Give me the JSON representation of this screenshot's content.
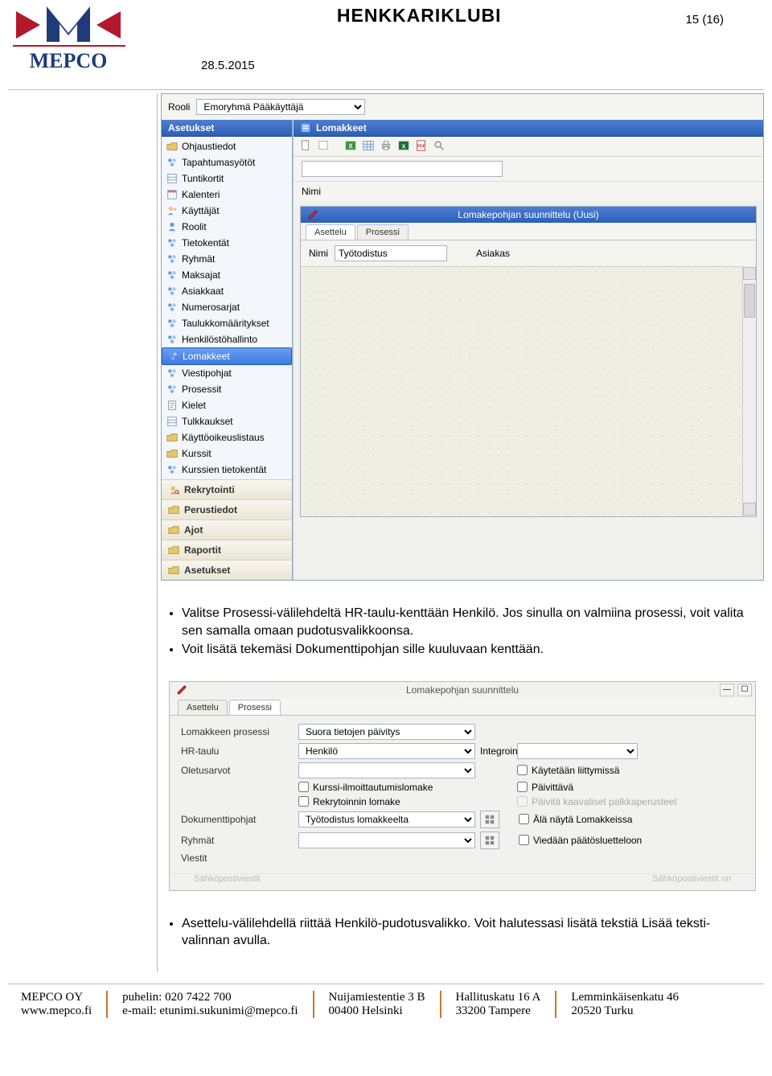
{
  "doc": {
    "title": "HENKKARIKLUBI",
    "page_label": "15 (16)",
    "date": "28.5.2015"
  },
  "app1": {
    "rooli_label": "Rooli",
    "rooli_value": "Emoryhmä Pääkäyttäjä",
    "sidebar_title": "Asetukset",
    "content_title": "Lomakkeet",
    "nav": [
      "Ohjaustiedot",
      "Tapahtumasyötöt",
      "Tuntikortit",
      "Kalenteri",
      "Käyttäjät",
      "Roolit",
      "Tietokentät",
      "Ryhmät",
      "Maksajat",
      "Asiakkaat",
      "Numerosarjat",
      "Taulukkomääritykset",
      "Henkilöstöhallinto",
      "Lomakkeet",
      "Viestipohjat",
      "Prosessit",
      "Kielet",
      "Tulkkaukset",
      "Käyttöoikeuslistaus",
      "Kurssit",
      "Kurssien tietokentät"
    ],
    "nav_selected_index": 13,
    "side_buttons": [
      "Rekrytointi",
      "Perustiedot",
      "Ajot",
      "Raportit",
      "Asetukset"
    ],
    "search_label": "Nimi",
    "subwin_title_text": "Lomakepohjan suunnittelu (Uusi)",
    "tabs": [
      "Asettelu",
      "Prosessi"
    ],
    "active_tab_index": 0,
    "form_nimi_label": "Nimi",
    "form_nimi_value": "Työtodistus",
    "form_asiakas_label": "Asiakas"
  },
  "bullets1": [
    "Valitse Prosessi-välilehdeltä HR-taulu-kenttään Henkilö. Jos sinulla on valmiina prosessi, voit valita sen samalla omaan pudotusvalikkoonsa.",
    "Voit lisätä tekemäsi Dokumenttipohjan sille kuuluvaan kenttään."
  ],
  "app2": {
    "title": "Lomakepohjan suunnittelu",
    "tabs": [
      "Asettelu",
      "Prosessi"
    ],
    "active_tab_index": 1,
    "rows": {
      "process_label": "Lomakkeen prosessi",
      "process_value": "Suora tietojen päivitys",
      "hr_label": "HR-taulu",
      "hr_value": "Henkilö",
      "integrointi_label": "Integrointi",
      "oletus_label": "Oletusarvot",
      "chk_liittymissa": "Käytetään liittymissä",
      "chk_kurssi": "Kurssi-ilmoittautumislomake",
      "chk_paivittava": "Päivittävä",
      "chk_rekry": "Rekrytoinnin lomake",
      "chk_paivita_disabled": "Päivitä kaavaliset palkkaperusteet",
      "dokpohjat_label": "Dokumenttipohjat",
      "dokpohjat_value": "Työtodistus lomakkeelta",
      "chk_alanayta": "Älä näytä Lomakkeissa",
      "ryhmat_label": "Ryhmät",
      "chk_viedaan": "Viedään päätösluetteloon",
      "viestit_label": "Viestit",
      "cut_left": "Sähköpostiviestit",
      "cut_right": "Sähköpostiviestit nn"
    }
  },
  "bullets2": [
    "Asettelu-välilehdellä riittää Henkilö-pudotusvalikko. Voit halutessasi lisätä tekstiä Lisää teksti-valinnan avulla."
  ],
  "footer": {
    "c1a": "MEPCO OY",
    "c1b": "www.mepco.fi",
    "c2a": "puhelin: 020 7422 700",
    "c2b": "e-mail: etunimi.sukunimi@mepco.fi",
    "c3a": "Nuijamiestentie 3 B",
    "c3b": "00400 Helsinki",
    "c4a": "Hallituskatu 16 A",
    "c4b": "33200 Tampere",
    "c5a": "Lemminkäisenkatu 46",
    "c5b": "20520 Turku"
  }
}
